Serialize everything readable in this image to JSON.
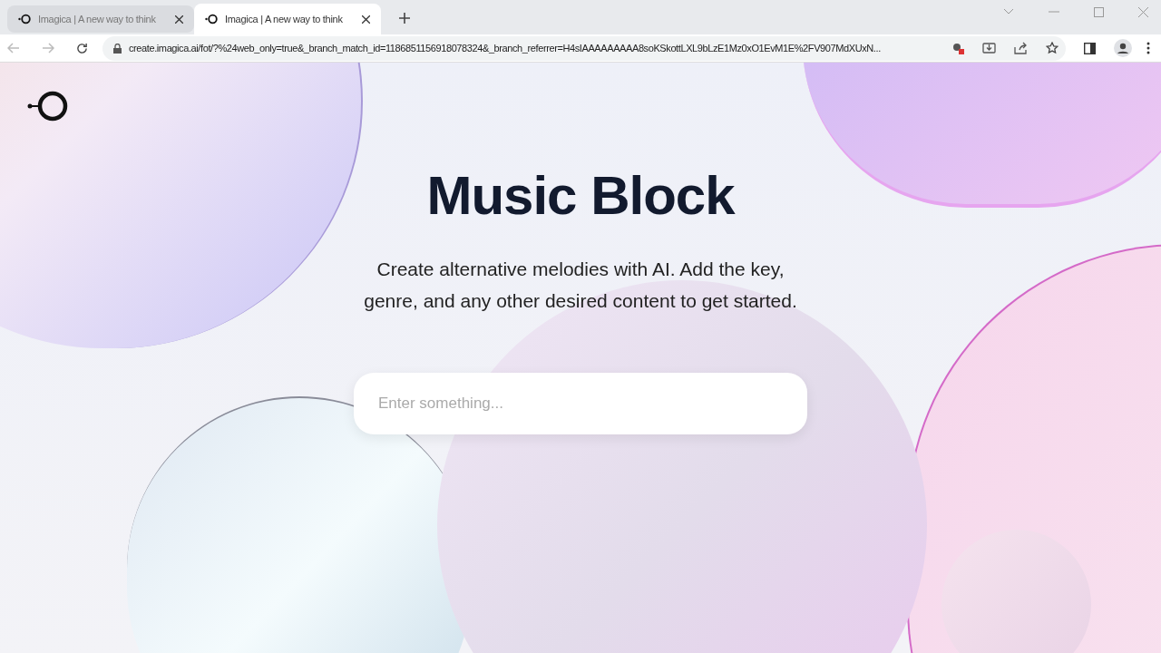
{
  "tabs": [
    {
      "title": "Imagica | A new way to think",
      "selected": false
    },
    {
      "title": "Imagica | A new way to think",
      "selected": true
    }
  ],
  "address_bar": {
    "url": "create.imagica.ai/fot/?%24web_only=true&_branch_match_id=1186851156918078324&_branch_referrer=H4sIAAAAAAAAA8soKSkottLXL9bLzE1Mz0xO1EvM1E%2FV907MdXUxN..."
  },
  "page": {
    "title": "Music Block",
    "description": "Create alternative melodies with AI. Add the key, genre, and any other desired content to get started.",
    "input": {
      "placeholder": "Enter something..."
    }
  }
}
